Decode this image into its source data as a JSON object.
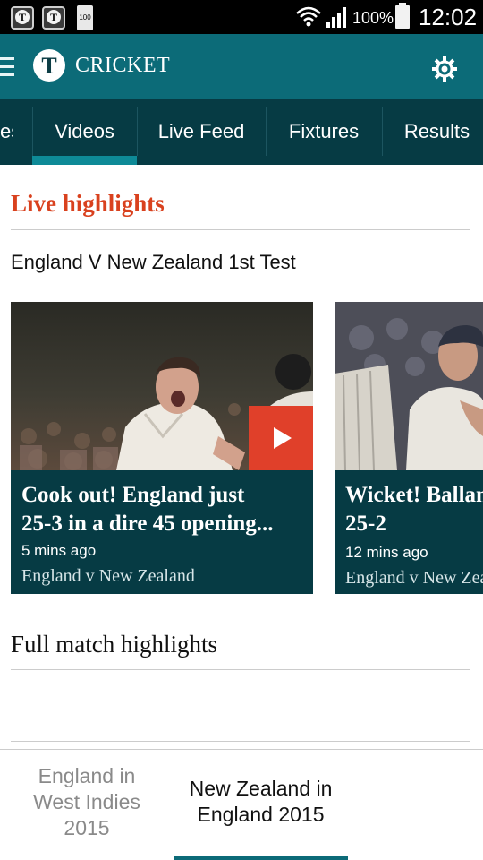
{
  "status_bar": {
    "notification_icon_1": "T",
    "notification_icon_2": "T",
    "small_battery_label": "100",
    "battery_percent": "100%",
    "time": "12:02"
  },
  "app_bar": {
    "logo_letter": "T",
    "title": "CRICKET",
    "menu_icon": "hamburger-icon",
    "settings_icon": "gear-icon"
  },
  "tabs": [
    {
      "label": "es",
      "selected": false
    },
    {
      "label": "Videos",
      "selected": true
    },
    {
      "label": "Live Feed",
      "selected": false
    },
    {
      "label": "Fixtures",
      "selected": false
    },
    {
      "label": "Results",
      "selected": false
    }
  ],
  "live_section": {
    "heading": "Live highlights",
    "match_title": "England V New Zealand 1st Test",
    "cards": [
      {
        "headline_line1": "Cook out! England just",
        "headline_line2": "25-3 in a dire 45 opening...",
        "time_ago": "5 mins ago",
        "match": "England v New Zealand",
        "has_play_button": true
      },
      {
        "headline_line1": "Wicket! Ballance",
        "headline_line2": "25-2",
        "time_ago": "12 mins ago",
        "match": "England v New Zealand",
        "has_play_button": false
      }
    ]
  },
  "full_section": {
    "heading": "Full match highlights",
    "bottom_tabs": [
      {
        "label_line1": "England in",
        "label_line2": "West Indies",
        "label_line3": "2015",
        "selected": false
      },
      {
        "label_line1": "New Zealand in",
        "label_line2": "England 2015",
        "selected": true
      }
    ]
  },
  "colors": {
    "app_bar": "#0c6b78",
    "tab_bar": "#063b44",
    "tab_indicator": "#0e8a97",
    "accent_red": "#d9411e",
    "card_background": "#063b44",
    "play_button": "#e0402a"
  }
}
